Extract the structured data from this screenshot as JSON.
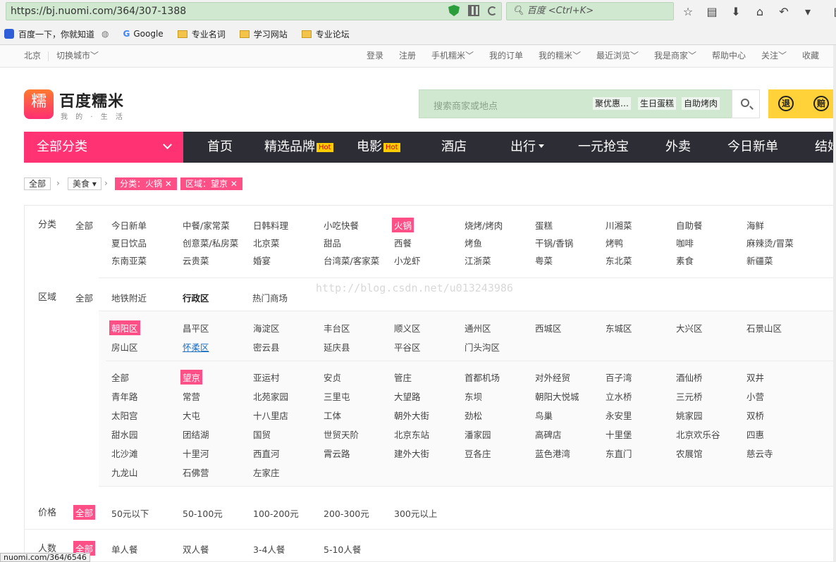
{
  "browser": {
    "url": "https://bj.nuomi.com/364/307-1388",
    "search_placeholder": "百度 <Ctrl+K>",
    "bookmarks": [
      "百度一下，你就知道",
      "Google",
      "专业名词",
      "学习网站",
      "专业论坛"
    ]
  },
  "topbar": {
    "city": "北京",
    "switch_city": "切换城市",
    "links": [
      "登录",
      "注册",
      "手机糯米",
      "我的订单",
      "我的糯米",
      "最近浏览",
      "我是商家",
      "帮助中心",
      "关注",
      "收藏"
    ]
  },
  "header": {
    "logo_char": "糯",
    "logo_text": "百度糯米",
    "slogan": "我 的 · 生 活",
    "search_placeholder": "搜索商家或地点",
    "hot_tags": [
      "聚优惠…",
      "生日蛋糕",
      "自助烤肉"
    ],
    "badges": [
      "退",
      "赔"
    ]
  },
  "nav": {
    "all_categories": "全部分类",
    "items": [
      "首页",
      "精选品牌",
      "电影",
      "酒店",
      "出行",
      "一元抢宝",
      "外卖",
      "今日新单",
      "结婚"
    ],
    "hot": "Hot"
  },
  "breadcrumb": {
    "all": "全部",
    "food": "美食",
    "cat_tag": "分类：火锅",
    "area_tag": "区域：望京"
  },
  "filters": {
    "category_label": "分类",
    "all": "全部",
    "categories": [
      [
        "今日新单",
        "中餐/家常菜",
        "日韩料理",
        "小吃快餐",
        "火锅",
        "烧烤/烤肉",
        "蛋糕",
        "川湘菜",
        "自助餐",
        "海鲜"
      ],
      [
        "夏日饮品",
        "创意菜/私房菜",
        "北京菜",
        "甜品",
        "西餐",
        "烤鱼",
        "干锅/香锅",
        "烤鸭",
        "咖啡",
        "麻辣烫/冒菜"
      ],
      [
        "东南亚菜",
        "云贵菜",
        "婚宴",
        "台湾菜/客家菜",
        "小龙虾",
        "江浙菜",
        "粤菜",
        "东北菜",
        "素食",
        "新疆菜"
      ]
    ],
    "area_label": "区域",
    "area_tabs": [
      "全部",
      "地铁附近",
      "行政区",
      "热门商场"
    ],
    "districts": [
      [
        "朝阳区",
        "昌平区",
        "海淀区",
        "丰台区",
        "顺义区",
        "通州区",
        "西城区",
        "东城区",
        "大兴区",
        "石景山区"
      ],
      [
        "房山区",
        "怀柔区",
        "密云县",
        "延庆县",
        "平谷区",
        "门头沟区"
      ]
    ],
    "subareas": [
      [
        "全部",
        "望京",
        "亚运村",
        "安贞",
        "管庄",
        "首都机场",
        "对外经贸",
        "百子湾",
        "酒仙桥",
        "双井"
      ],
      [
        "青年路",
        "常营",
        "北苑家园",
        "三里屯",
        "大望路",
        "东坝",
        "朝阳大悦城",
        "立水桥",
        "三元桥",
        "小营"
      ],
      [
        "太阳宫",
        "大屯",
        "十八里店",
        "工体",
        "朝外大街",
        "劲松",
        "鸟巢",
        "永安里",
        "姚家园",
        "双桥"
      ],
      [
        "甜水园",
        "团结湖",
        "国贸",
        "世贸天阶",
        "北京东站",
        "潘家园",
        "高碑店",
        "十里堡",
        "北京欢乐谷",
        "四惠"
      ],
      [
        "北沙滩",
        "十里河",
        "西直河",
        "霄云路",
        "建外大街",
        "豆各庄",
        "蓝色港湾",
        "东直门",
        "农展馆",
        "慈云寺"
      ],
      [
        "九龙山",
        "石佛营",
        "左家庄"
      ]
    ],
    "price_label": "价格",
    "prices": [
      "50元以下",
      "50-100元",
      "100-200元",
      "200-300元",
      "300元以上"
    ],
    "people_label": "人数",
    "people": [
      "单人餐",
      "双人餐",
      "3-4人餐",
      "5-10人餐"
    ]
  },
  "watermark": "http://blog.csdn.net/u013243986",
  "status_url": "nuomi.com/364/6546"
}
